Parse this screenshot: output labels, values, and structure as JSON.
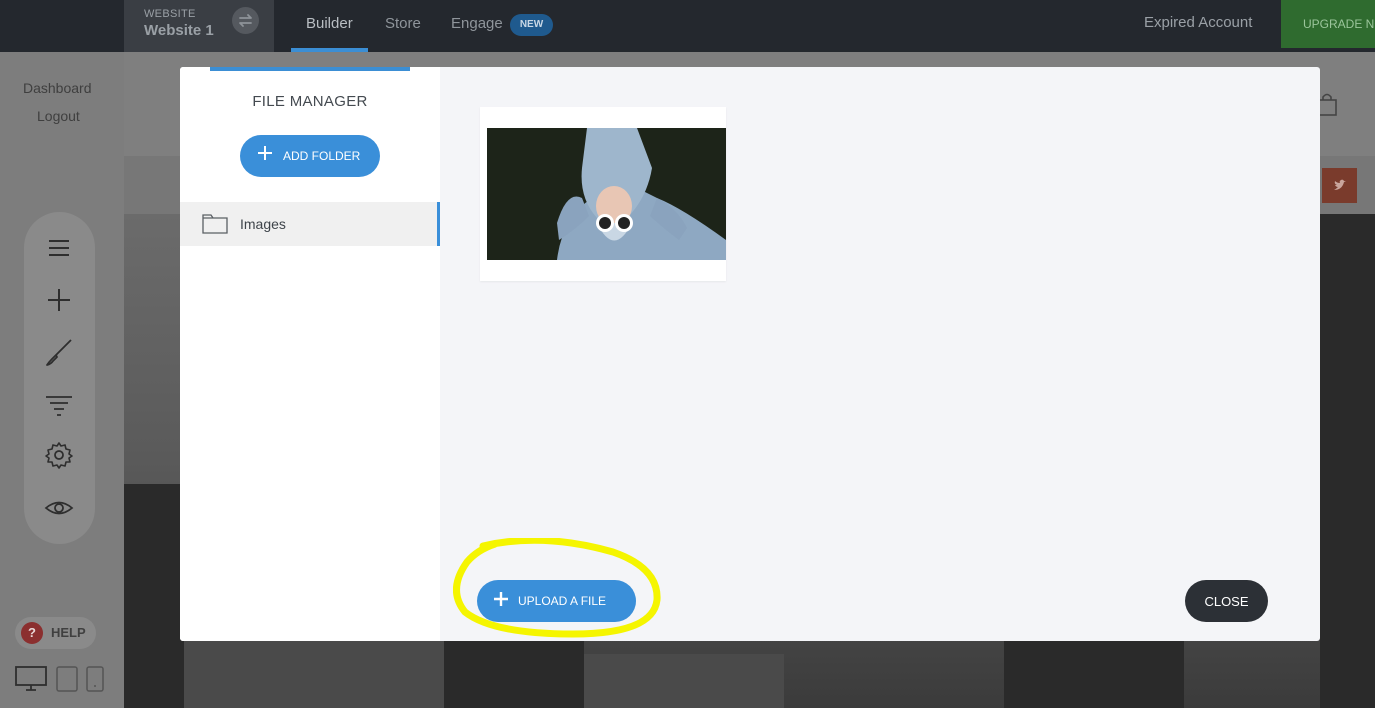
{
  "topbar": {
    "site_label": "WEBSITE",
    "site_name": "Website 1",
    "tabs": [
      {
        "label": "Builder",
        "active": true
      },
      {
        "label": "Store",
        "active": false
      },
      {
        "label": "Engage",
        "active": false
      }
    ],
    "engage_badge": "NEW",
    "account_status": "Expired Account",
    "upgrade_label": "UPGRADE NOW"
  },
  "sidebar": {
    "links": [
      "Dashboard",
      "Logout"
    ],
    "tools": [
      "menu-icon",
      "plus-icon",
      "brush-icon",
      "filter-icon",
      "gear-icon",
      "eye-icon"
    ],
    "help_label": "HELP",
    "devices": [
      "desktop-icon",
      "tablet-icon",
      "mobile-icon"
    ]
  },
  "file_manager": {
    "title": "FILE MANAGER",
    "add_folder_label": "ADD FOLDER",
    "folders": [
      {
        "name": "Images",
        "selected": true
      }
    ],
    "upload_label": "UPLOAD A FILE",
    "close_label": "CLOSE"
  },
  "colors": {
    "accent": "#3a8fd9",
    "dark": "#2c3036",
    "highlight": "#f5f500"
  }
}
